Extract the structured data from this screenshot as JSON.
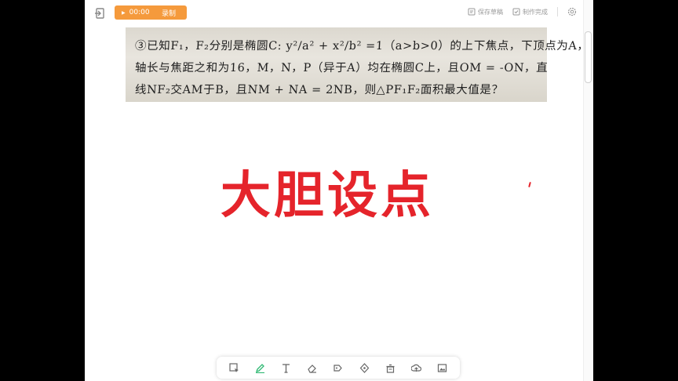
{
  "topbar": {
    "record_time": "00:00",
    "record_label": "录制",
    "save_draft_label": "保存草稿",
    "finish_label": "制作完成"
  },
  "photo": {
    "lines": [
      "③已知F₁，F₂分别是椭圆C: y²/a² + x²/b² =1（a>b>0）的上下焦点，下顶点为A，其长",
      "轴长与焦距之和为16，M，N，P（异于A）均在椭圆C上，且OM = ‑ON，直",
      "线NF₂交AM于B，且NM + NA = 2NB，则△PF₁F₂面积最大值是？"
    ]
  },
  "headline": "大胆设点",
  "toolbar": {
    "tools": [
      "select-icon",
      "pen-icon",
      "text-icon",
      "eraser-icon",
      "highlighter-icon",
      "laser-icon",
      "clear-icon",
      "shape-icon",
      "image-icon"
    ]
  },
  "colors": {
    "accent": "#f59a3c",
    "headline": "#e5242b",
    "pen_active": "#2eb872"
  }
}
